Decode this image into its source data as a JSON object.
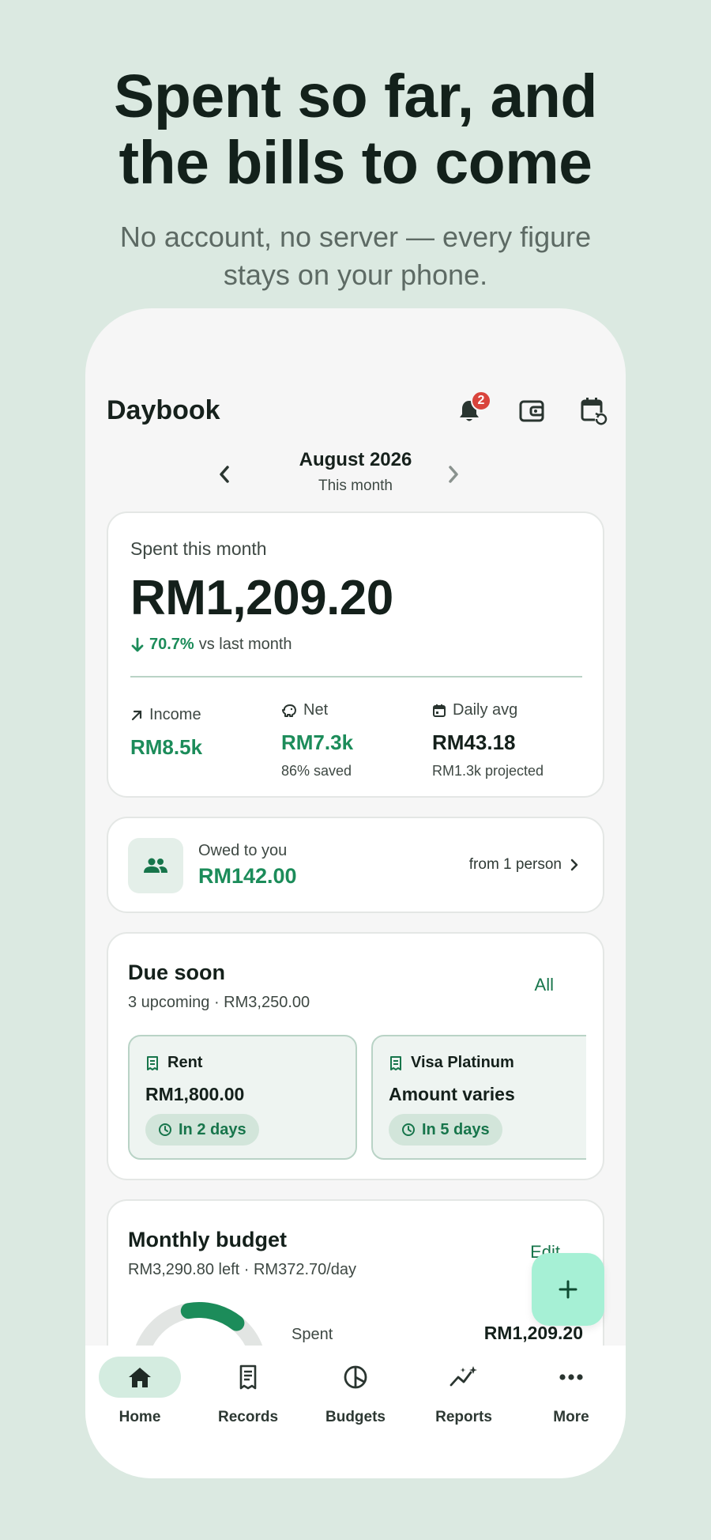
{
  "promo": {
    "headline_line1": "Spent so far, and",
    "headline_line2": "the bills to come",
    "subline_line1": "No account, no server — every figure",
    "subline_line2": "stays on your phone."
  },
  "appbar": {
    "title": "Daybook",
    "notification_count": "2",
    "icons": [
      "bell-icon",
      "wallet-icon",
      "calendar-refresh-icon"
    ]
  },
  "month_nav": {
    "title": "August 2026",
    "subtitle": "This month"
  },
  "summary": {
    "label": "Spent this month",
    "amount": "RM1,209.20",
    "trend_pct": "70.7%",
    "trend_text": "vs last month",
    "trend_direction": "down",
    "income": {
      "label": "Income",
      "value": "RM8.5k"
    },
    "net": {
      "label": "Net",
      "value": "RM7.3k",
      "sub": "86% saved"
    },
    "daily_avg": {
      "label": "Daily avg",
      "value": "RM43.18",
      "sub": "RM1.3k projected"
    }
  },
  "owed": {
    "label": "Owed to you",
    "amount": "RM142.00",
    "from": "from 1 person"
  },
  "due_soon": {
    "title": "Due soon",
    "subtitle": "3 upcoming · RM3,250.00",
    "all_label": "All",
    "bills": [
      {
        "name": "Rent",
        "amount": "RM1,800.00",
        "due": "In 2 days"
      },
      {
        "name": "Visa Platinum",
        "amount": "Amount varies",
        "due": "In 5 days"
      }
    ]
  },
  "budget": {
    "title": "Monthly budget",
    "subtitle": "RM3,290.80 left · RM372.70/day",
    "edit_label": "Edit",
    "spent_label": "Spent",
    "spent_value": "RM1,209.20",
    "spent_fraction": 0.27
  },
  "nav": {
    "items": [
      {
        "label": "Home",
        "icon": "home-icon",
        "active": true
      },
      {
        "label": "Records",
        "icon": "receipt-icon",
        "active": false
      },
      {
        "label": "Budgets",
        "icon": "pie-icon",
        "active": false
      },
      {
        "label": "Reports",
        "icon": "chart-sparkle-icon",
        "active": false
      },
      {
        "label": "More",
        "icon": "more-icon",
        "active": false
      }
    ]
  },
  "colors": {
    "accent": "#1c8c5a",
    "accent_dark": "#17754b",
    "background": "#dbe9e1",
    "fab": "#a6f0d5",
    "badge": "#d9443c"
  }
}
